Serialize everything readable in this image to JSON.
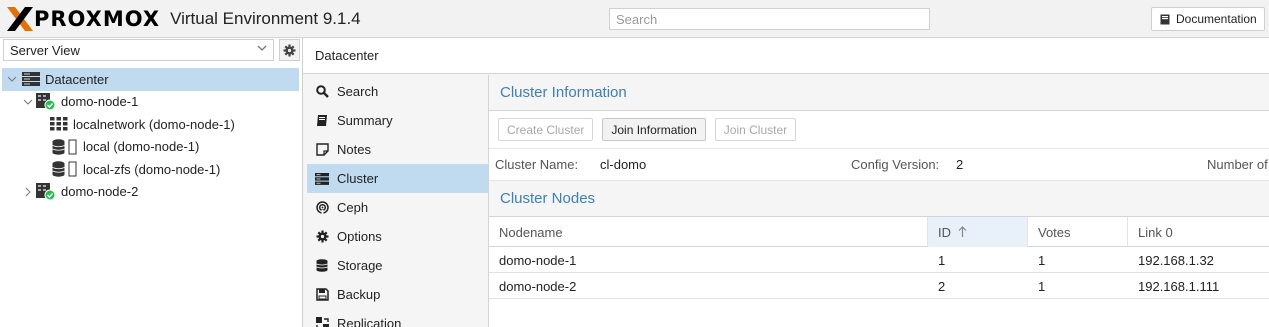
{
  "header": {
    "brand": "PROXMOX",
    "product": "Virtual Environment 9.1.4",
    "search_placeholder": "Search",
    "doc_label": "Documentation"
  },
  "left": {
    "view_label": "Server View",
    "tree": [
      {
        "label": "Datacenter",
        "icon": "datacenter-icon"
      },
      {
        "label": "domo-node-1",
        "icon": "node-online-icon"
      },
      {
        "label": "localnetwork (domo-node-1)",
        "icon": "network-grid-icon"
      },
      {
        "label": "local (domo-node-1)",
        "icon": "storage-icon"
      },
      {
        "label": "local-zfs (domo-node-1)",
        "icon": "storage-icon"
      },
      {
        "label": "domo-node-2",
        "icon": "node-online-icon"
      }
    ]
  },
  "breadcrumb": "Datacenter",
  "menu": [
    {
      "label": "Search",
      "icon": "search-icon"
    },
    {
      "label": "Summary",
      "icon": "book-icon"
    },
    {
      "label": "Notes",
      "icon": "notes-icon"
    },
    {
      "label": "Cluster",
      "icon": "server-icon"
    },
    {
      "label": "Ceph",
      "icon": "ceph-icon"
    },
    {
      "label": "Options",
      "icon": "gear-icon"
    },
    {
      "label": "Storage",
      "icon": "database-icon"
    },
    {
      "label": "Backup",
      "icon": "floppy-icon"
    },
    {
      "label": "Replication",
      "icon": "replication-icon"
    }
  ],
  "cluster_info": {
    "title": "Cluster Information",
    "buttons": {
      "create": "Create Cluster",
      "join_info": "Join Information",
      "join": "Join Cluster"
    },
    "name_label": "Cluster Name:",
    "name_value": "cl-domo",
    "config_label": "Config Version:",
    "config_value": "2",
    "number_label": "Number of"
  },
  "cluster_nodes": {
    "title": "Cluster Nodes",
    "columns": {
      "nodename": "Nodename",
      "id": "ID",
      "votes": "Votes",
      "link0": "Link 0"
    },
    "rows": [
      {
        "nodename": "domo-node-1",
        "id": "1",
        "votes": "1",
        "link0": "192.168.1.32"
      },
      {
        "nodename": "domo-node-2",
        "id": "2",
        "votes": "1",
        "link0": "192.168.1.111"
      }
    ]
  },
  "colors": {
    "accent": "#3d7fb8",
    "selected": "#c0dbf0",
    "online": "#21bf4b",
    "logo_orange": "#e57000"
  }
}
